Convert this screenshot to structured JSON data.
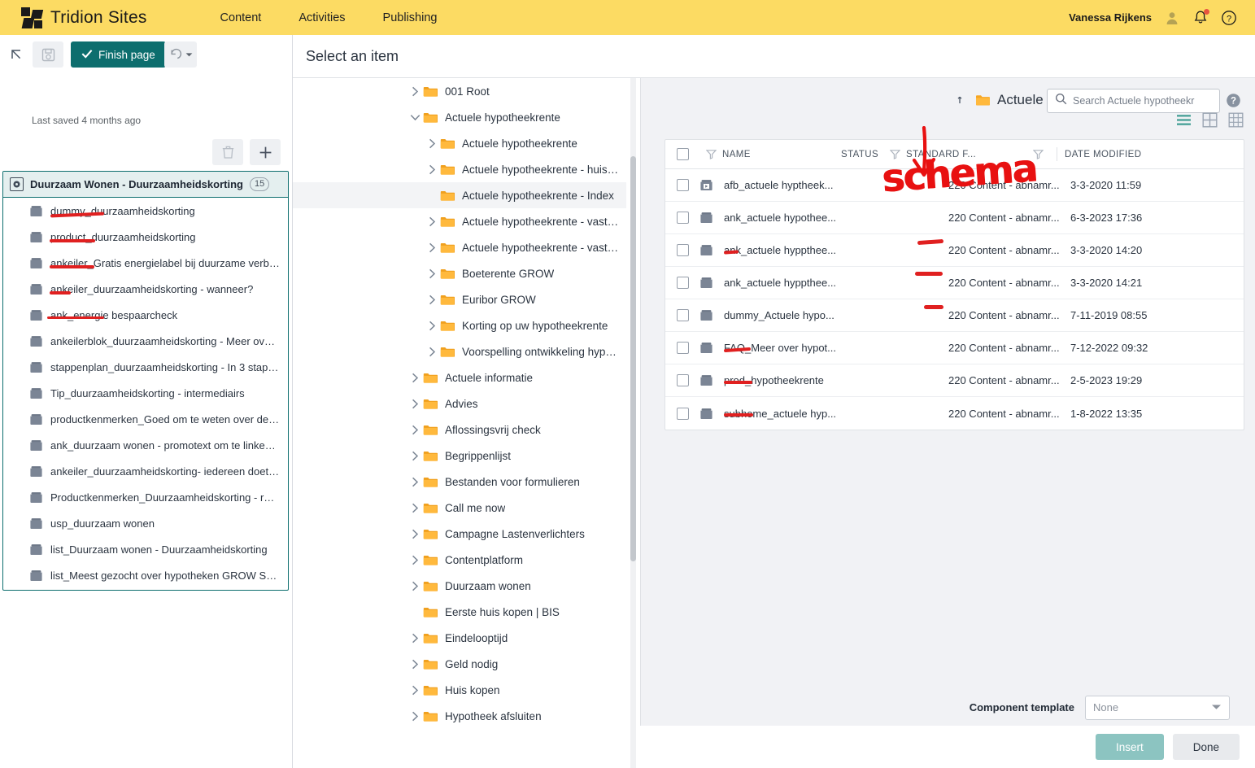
{
  "topbar": {
    "brand": "Tridion Sites",
    "nav": [
      {
        "label": "Content"
      },
      {
        "label": "Activities"
      },
      {
        "label": "Publishing"
      }
    ],
    "user": "Vanessa Rijkens",
    "icons": {
      "user": "user-icon",
      "notifications": "bell-icon",
      "help": "help-icon"
    }
  },
  "left_panel": {
    "toolbar": {
      "pointer_icon": "pointer-arrow-icon",
      "save_icon": "save-disk-icon",
      "finish_label": "Finish page",
      "undo_icon": "undo-icon",
      "last_saved": "Last saved 4 months ago",
      "delete_icon": "trash-icon",
      "add_icon": "plus-icon"
    },
    "component_list": {
      "title": "Duurzaam Wonen - Duurzaamheidskorting",
      "count": "15",
      "items": [
        {
          "label": "dummy_duurzaamheidskorting"
        },
        {
          "label": "product_duurzaamheidskorting"
        },
        {
          "label": "ankeiler_Gratis energielabel bij duurzame verbou..."
        },
        {
          "label": "ankeiler_duurzaamheidskorting - wanneer?"
        },
        {
          "label": "ank_energie bespaarcheck"
        },
        {
          "label": "ankeilerblok_duurzaamheidskorting - Meer over h..."
        },
        {
          "label": "stappenplan_duurzaamheidskorting - In 3 stappen..."
        },
        {
          "label": "Tip_duurzaamheidskorting - intermediairs"
        },
        {
          "label": "productkenmerken_Goed om te weten over de du..."
        },
        {
          "label": "ank_duurzaam wonen - promotext om te linken n..."
        },
        {
          "label": "ankeiler_duurzaamheidskorting- iedereen doet W..."
        },
        {
          "label": "Productkenmerken_Duurzaamheidskorting - reke..."
        },
        {
          "label": "usp_duurzaam wonen"
        },
        {
          "label": "list_Duurzaam wonen - Duurzaamheidskorting"
        },
        {
          "label": "list_Meest gezocht over hypotheken GROW SEO"
        }
      ]
    }
  },
  "center": {
    "title": "Select an item",
    "tree": [
      {
        "label": "001 Root",
        "indent": 0,
        "caret": "right",
        "selected": false
      },
      {
        "label": "Actuele hypotheekrente",
        "indent": 0,
        "caret": "down",
        "selected": false
      },
      {
        "label": "Actuele hypotheekrente",
        "indent": 1,
        "caret": "right",
        "selected": false
      },
      {
        "label": "Actuele hypotheekrente - huisbank...",
        "indent": 1,
        "caret": "right",
        "selected": false
      },
      {
        "label": "Actuele hypotheekrente - Index",
        "indent": 1,
        "caret": "none",
        "selected": true
      },
      {
        "label": "Actuele hypotheekrente - vaste of ...",
        "indent": 1,
        "caret": "right",
        "selected": false
      },
      {
        "label": "Actuele hypotheekrente - vaste ren...",
        "indent": 1,
        "caret": "right",
        "selected": false
      },
      {
        "label": "Boeterente GROW",
        "indent": 1,
        "caret": "right",
        "selected": false
      },
      {
        "label": "Euribor GROW",
        "indent": 1,
        "caret": "right",
        "selected": false
      },
      {
        "label": "Korting op uw hypotheekrente",
        "indent": 1,
        "caret": "right",
        "selected": false
      },
      {
        "label": "Voorspelling ontwikkeling hypothe...",
        "indent": 1,
        "caret": "right",
        "selected": false
      },
      {
        "label": "Actuele informatie",
        "indent": 0,
        "caret": "right",
        "selected": false
      },
      {
        "label": "Advies",
        "indent": 0,
        "caret": "right",
        "selected": false
      },
      {
        "label": "Aflossingsvrij check",
        "indent": 0,
        "caret": "right",
        "selected": false
      },
      {
        "label": "Begrippenlijst",
        "indent": 0,
        "caret": "right",
        "selected": false
      },
      {
        "label": "Bestanden voor formulieren",
        "indent": 0,
        "caret": "right",
        "selected": false
      },
      {
        "label": "Call me now",
        "indent": 0,
        "caret": "right",
        "selected": false
      },
      {
        "label": "Campagne Lastenverlichters",
        "indent": 0,
        "caret": "right",
        "selected": false
      },
      {
        "label": "Contentplatform",
        "indent": 0,
        "caret": "right",
        "selected": false
      },
      {
        "label": "Duurzaam wonen",
        "indent": 0,
        "caret": "right",
        "selected": false
      },
      {
        "label": "Eerste huis kopen | BIS",
        "indent": 0,
        "caret": "none",
        "selected": false
      },
      {
        "label": "Eindelooptijd",
        "indent": 0,
        "caret": "right",
        "selected": false
      },
      {
        "label": "Geld nodig",
        "indent": 0,
        "caret": "right",
        "selected": false
      },
      {
        "label": "Huis kopen",
        "indent": 0,
        "caret": "right",
        "selected": false
      },
      {
        "label": "Hypotheek afsluiten",
        "indent": 0,
        "caret": "right",
        "selected": false
      }
    ]
  },
  "item_panel": {
    "breadcrumb": {
      "up_icon": "up-level-icon",
      "folder_icon": "folder-icon",
      "label": "Actuele hypotheekrente - Index"
    },
    "search": {
      "placeholder": "Search Actuele hypotheekr",
      "value": "",
      "icon": "search-icon"
    },
    "help_icon": "help-circle-icon",
    "view_modes": [
      {
        "name": "list-view-icon",
        "active": true
      },
      {
        "name": "grid-view-icon",
        "active": false
      },
      {
        "name": "table-view-icon",
        "active": false
      }
    ],
    "columns": {
      "name": "NAME",
      "status": "STATUS",
      "schema": "STANDARD F...",
      "date_modified": "DATE MODIFIED"
    },
    "rows": [
      {
        "icon": "multimedia-component-icon",
        "name": "afb_actuele hyptheek...",
        "status": "",
        "schema": "220 Content - abnamr...",
        "date": "3-3-2020 11:59"
      },
      {
        "icon": "component-icon",
        "name": "ank_actuele hypothee...",
        "status": "",
        "schema": "220 Content - abnamr...",
        "date": "6-3-2023 17:36"
      },
      {
        "icon": "component-icon",
        "name": "ank_actuele hyppthee...",
        "status": "",
        "schema": "220 Content - abnamr...",
        "date": "3-3-2020 14:20"
      },
      {
        "icon": "component-icon",
        "name": "ank_actuele hyppthee...",
        "status": "",
        "schema": "220 Content - abnamr...",
        "date": "3-3-2020 14:21"
      },
      {
        "icon": "component-icon",
        "name": "dummy_Actuele hypo...",
        "status": "",
        "schema": "220 Content - abnamr...",
        "date": "7-11-2019 08:55"
      },
      {
        "icon": "component-icon",
        "name": "FAQ_Meer over hypot...",
        "status": "",
        "schema": "220 Content - abnamr...",
        "date": "7-12-2022 09:32"
      },
      {
        "icon": "component-icon",
        "name": "prod_hypotheekrente",
        "status": "",
        "schema": "220 Content - abnamr...",
        "date": "2-5-2023 19:29"
      },
      {
        "icon": "component-icon",
        "name": "subhome_actuele hyp...",
        "status": "",
        "schema": "220 Content - abnamr...",
        "date": "1-8-2022 13:35"
      }
    ],
    "component_template": {
      "label": "Component template",
      "value": "None"
    },
    "footer": {
      "insert_label": "Insert",
      "done_label": "Done"
    }
  },
  "annotations": {
    "handwriting": "schema",
    "color": "#e81111"
  }
}
